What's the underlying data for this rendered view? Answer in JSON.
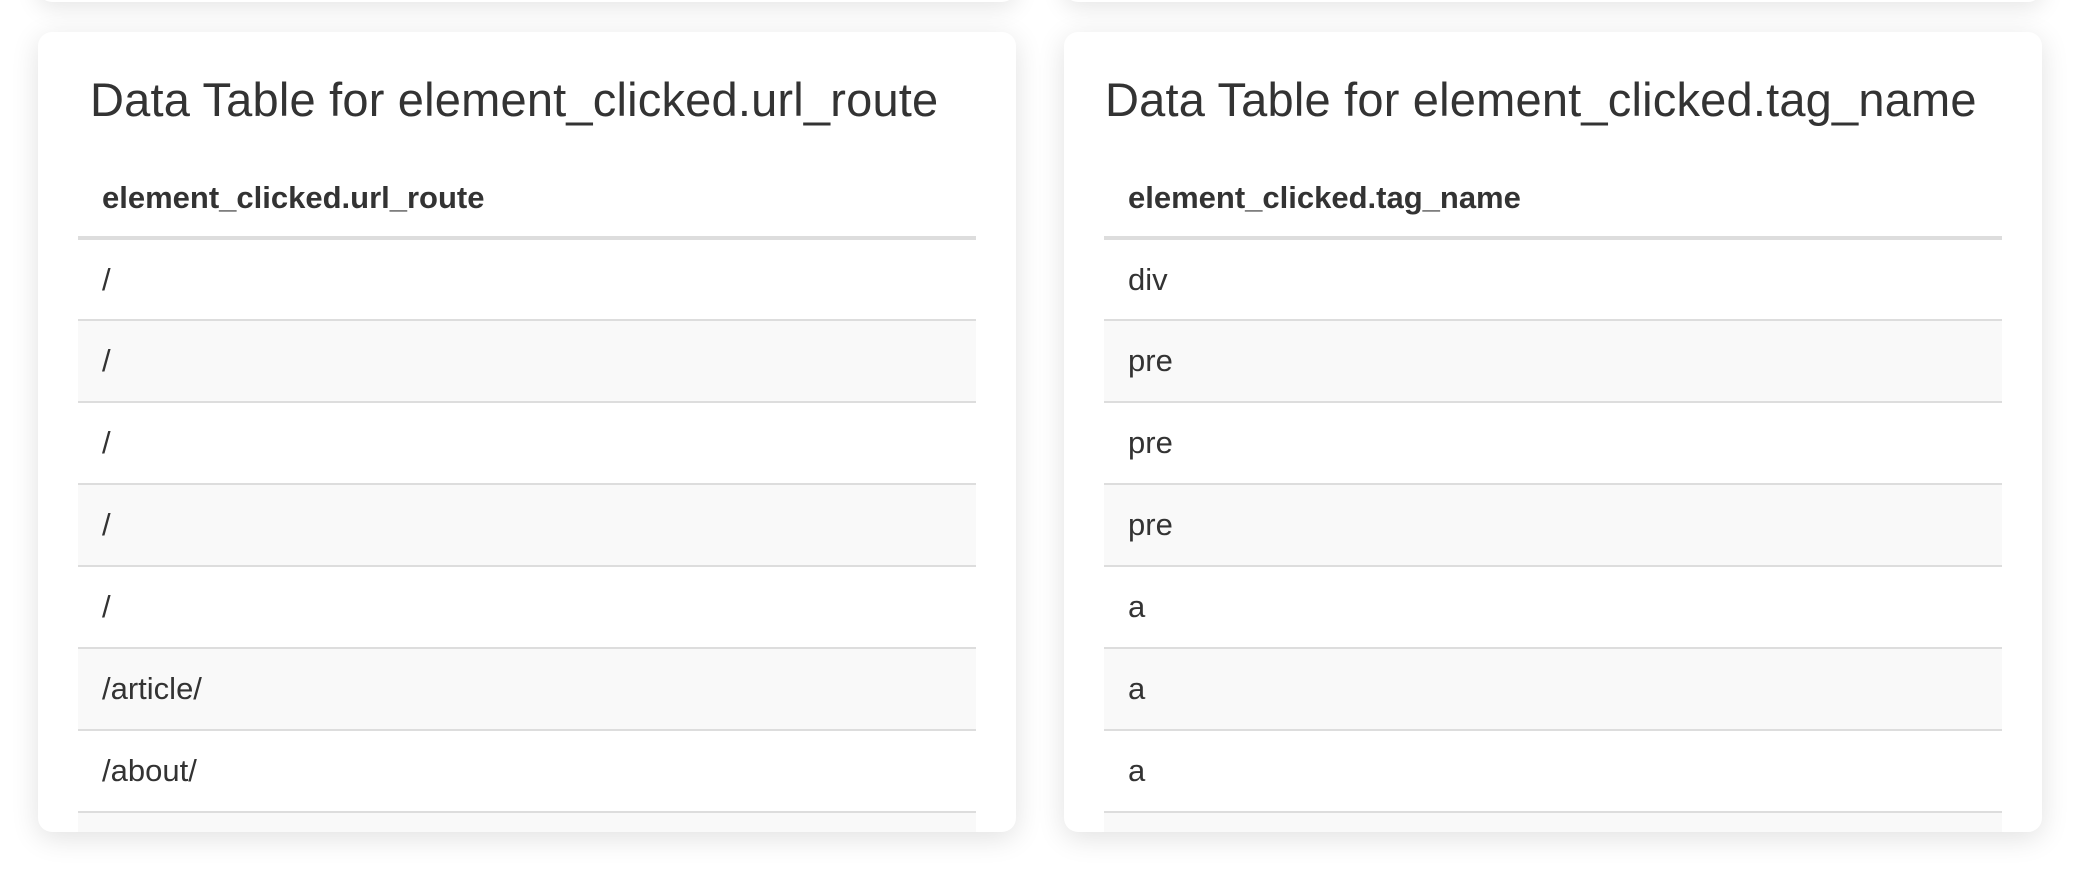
{
  "left_table": {
    "title": "Data Table for element_clicked.url_route",
    "column_header": "element_clicked.url_route",
    "rows": [
      "/",
      "/",
      "/",
      "/",
      "/",
      "/article/",
      "/about/",
      ""
    ]
  },
  "right_table": {
    "title": "Data Table for element_clicked.tag_name",
    "column_header": "element_clicked.tag_name",
    "rows": [
      "div",
      "pre",
      "pre",
      "pre",
      "a",
      "a",
      "a",
      ""
    ]
  }
}
